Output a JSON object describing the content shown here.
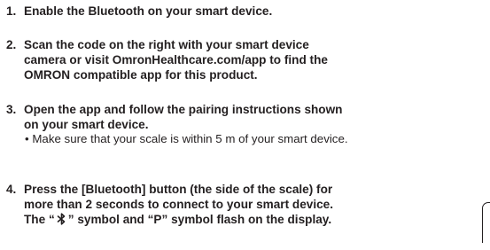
{
  "steps": [
    {
      "number": "1.",
      "lines": [
        "Enable the Bluetooth on your smart device."
      ]
    },
    {
      "number": "2.",
      "lines": [
        "Scan the code on the right with your smart device",
        "camera or visit OmronHealthcare.com/app to find the",
        "OMRON compatible app for this product."
      ]
    },
    {
      "number": "3.",
      "lines": [
        "Open the app and follow the pairing instructions shown",
        "on your smart device."
      ],
      "note": "• Make sure that your scale is within 5 m of your smart device."
    },
    {
      "number": "4.",
      "lines": [
        "Press the [Bluetooth] button (the side of the scale) for",
        "more than 2 seconds to connect to your smart device."
      ],
      "last_line_before": "The “",
      "last_line_after": "” symbol and “P” symbol flash on the display.",
      "symbol_icon": "bluetooth-icon"
    }
  ]
}
